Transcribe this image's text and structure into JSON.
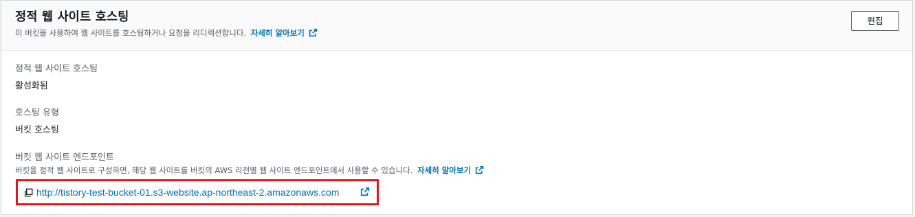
{
  "panel": {
    "title": "정적 웹 사이트 호스팅",
    "description": "이 버킷을 사용하여 웹 사이트를 호스팅하거나 요청을 리디렉션합니다.",
    "learn_more": "자세히 알아보기",
    "edit_label": "편집"
  },
  "fields": {
    "hosting": {
      "label": "정적 웹 사이트 호스팅",
      "value": "활성화됨"
    },
    "hosting_type": {
      "label": "호스팅 유형",
      "value": "버킷 호스팅"
    },
    "endpoint": {
      "label": "버킷 웹 사이트 엔드포인트",
      "description": "버킷을 정적 웹 사이트로 구성하면, 해당 웹 사이트를 버킷의 AWS 리전별 웹 사이트 엔드포인트에서 사용할 수 있습니다.",
      "learn_more": "자세히 알아보기",
      "url": "http://tistory-test-bucket-01.s3-website.ap-northeast-2.amazonaws.com"
    }
  },
  "icons": {
    "external_link": "external-link-icon",
    "copy": "copy-icon"
  },
  "colors": {
    "link": "#0073bb",
    "highlight_border": "#e0171e",
    "text_primary": "#16191f",
    "text_secondary": "#545b64"
  }
}
